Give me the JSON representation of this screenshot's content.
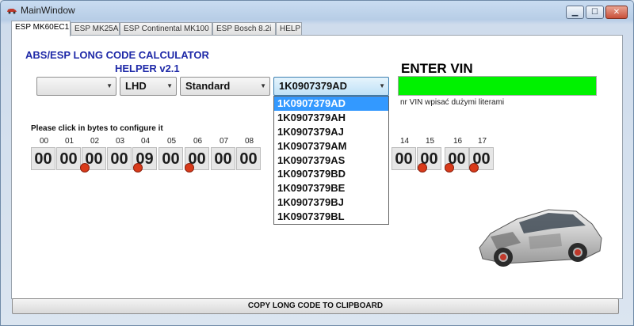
{
  "window": {
    "title": "MainWindow",
    "minimize_label": "▁",
    "maximize_label": "☐",
    "close_label": "✕"
  },
  "tabs": [
    {
      "label": "ESP MK60EC1",
      "active": true
    },
    {
      "label": "ESP MK25A",
      "active": false
    },
    {
      "label": "ESP Continental MK100",
      "active": false
    },
    {
      "label": "ESP Bosch 8.2i",
      "active": false
    },
    {
      "label": "HELP",
      "active": false
    }
  ],
  "main": {
    "heading_line1": "ABS/ESP LONG CODE CALCULATOR",
    "heading_line2": "HELPER v2.1",
    "enter_vin_label": "ENTER VIN",
    "vin_value": "",
    "vin_hint": "nr VIN wpisać dużymi literami",
    "vin_field_color": "#00f200",
    "combos": {
      "first": "",
      "drive": "LHD",
      "variant": "Standard",
      "code": "1K0907379AD"
    },
    "dropdown_options": [
      "1K0907379AD",
      "1K0907379AH",
      "1K0907379AJ",
      "1K0907379AM",
      "1K0907379AS",
      "1K0907379BD",
      "1K0907379BE",
      "1K0907379BJ",
      "1K0907379BL"
    ],
    "dropdown_selected": "1K0907379AD",
    "bytes_label": "Please click in bytes to configure it",
    "byte_indexes": [
      "00",
      "01",
      "02",
      "03",
      "04",
      "05",
      "06",
      "07",
      "08",
      "14",
      "15",
      "16",
      "17"
    ],
    "byte_values": [
      "00",
      "00",
      "00",
      "00",
      "09",
      "00",
      "00",
      "00",
      "00",
      "00",
      "00",
      "00",
      "00"
    ],
    "badge_color": "#d93a1a",
    "copy_button_label": "COPY LONG CODE TO CLIPBOARD"
  }
}
